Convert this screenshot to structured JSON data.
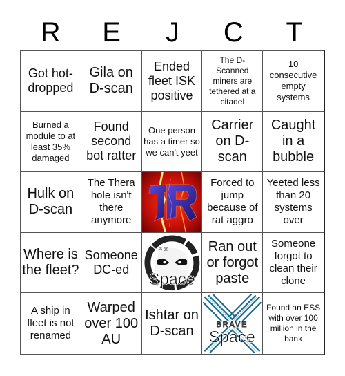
{
  "header": {
    "letters": [
      "R",
      "E",
      "J",
      "C",
      "T"
    ]
  },
  "cells": [
    {
      "text": "Got hot-dropped",
      "size": "lg"
    },
    {
      "text": "Gila on D-scan",
      "size": "xl"
    },
    {
      "text": "Ended fleet ISK positive",
      "size": "lg"
    },
    {
      "text": "The D-Scanned miners are tethered at a citadel",
      "size": "xs"
    },
    {
      "text": "10 consecutive empty systems",
      "size": "sm"
    },
    {
      "text": "Burned a module to at least 35% damaged",
      "size": "sm"
    },
    {
      "text": "Found second bot ratter",
      "size": "lg"
    },
    {
      "text": "One person has a timer so we can't yeet",
      "size": "sm"
    },
    {
      "text": "Carrier on D-scan",
      "size": "xl"
    },
    {
      "text": "Caught in a bubble",
      "size": "xl"
    },
    {
      "text": "Hulk on D-scan",
      "size": "xl"
    },
    {
      "text": "The Thera hole isn't there anymore",
      "size": "md"
    },
    {
      "image": "lr-logo-icon"
    },
    {
      "text": "Forced to jump because of rat aggro",
      "size": "md"
    },
    {
      "text": "Yeeted less than 20 systems over",
      "size": "md"
    },
    {
      "text": "Where is the fleet?",
      "size": "xl"
    },
    {
      "text": "Someone DC-ed",
      "size": "lg"
    },
    {
      "image": "space-panda-logo-icon",
      "caption": "Space"
    },
    {
      "text": "Ran out or forgot paste",
      "size": "xl"
    },
    {
      "text": "Someone forgot to clean their clone",
      "size": "md"
    },
    {
      "text": "A ship in fleet is not renamed",
      "size": "md"
    },
    {
      "text": "Warped over 100 AU",
      "size": "xl"
    },
    {
      "text": "Ishtar on D-scan",
      "size": "xl"
    },
    {
      "image": "brave-space-logo-icon",
      "caption_top": "BRAVE",
      "caption": "Space"
    },
    {
      "text": "Found an ESS with over 100 million in the bank",
      "size": "xs"
    }
  ]
}
